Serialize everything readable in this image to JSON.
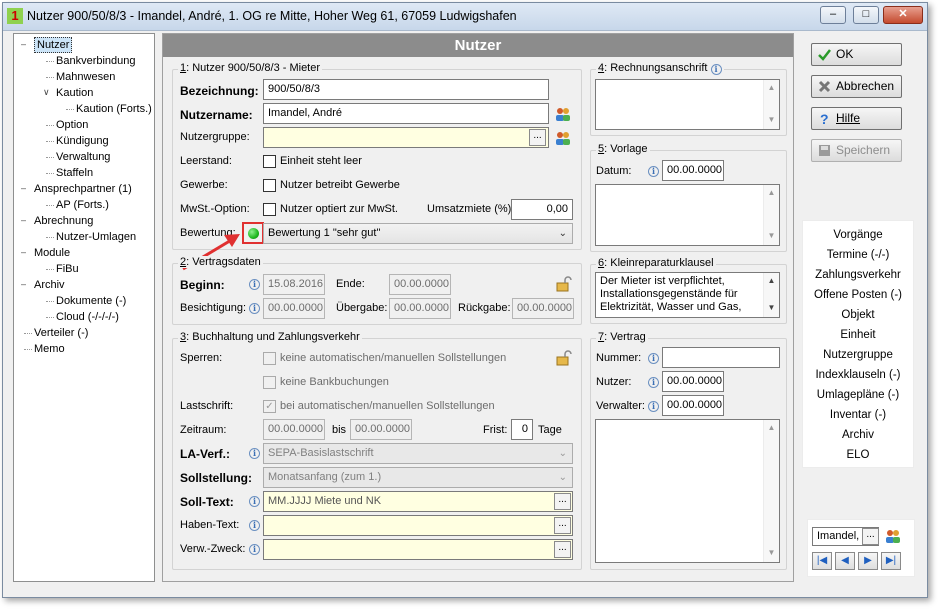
{
  "window": {
    "title": "Nutzer 900/50/8/3 - Imandel, André, 1. OG re Mitte, Hoher Weg 61, 67059 Ludwigshafen"
  },
  "tree": [
    {
      "label": "Nutzer",
      "level": 0,
      "toggle": "-"
    },
    {
      "label": "Bankverbindung",
      "level": 1
    },
    {
      "label": "Mahnwesen",
      "level": 1
    },
    {
      "label": "Kaution",
      "level": 1,
      "toggle": "v"
    },
    {
      "label": "Kaution (Forts.)",
      "level": 2
    },
    {
      "label": "Option",
      "level": 1
    },
    {
      "label": "Kündigung",
      "level": 1
    },
    {
      "label": "Verwaltung",
      "level": 1
    },
    {
      "label": "Staffeln",
      "level": 1
    },
    {
      "label": "Ansprechpartner (1)",
      "level": 0,
      "toggle": "-"
    },
    {
      "label": "AP (Forts.)",
      "level": 1
    },
    {
      "label": "Abrechnung",
      "level": 0,
      "toggle": "-"
    },
    {
      "label": "Nutzer-Umlagen",
      "level": 1
    },
    {
      "label": "Module",
      "level": 0,
      "toggle": "-"
    },
    {
      "label": "FiBu",
      "level": 1
    },
    {
      "label": "Archiv",
      "level": 0,
      "toggle": "-"
    },
    {
      "label": "Dokumente (-)",
      "level": 1
    },
    {
      "label": "Cloud (-/-/-/-)",
      "level": 1
    },
    {
      "label": "Verteiler (-)",
      "level": 0
    },
    {
      "label": "Memo",
      "level": 0
    }
  ],
  "main": {
    "header": "Nutzer"
  },
  "g1": {
    "num": "1",
    "title": ": Nutzer 900/50/8/3 - Mieter",
    "bezeichnung_label": "Bezeichnung:",
    "bezeichnung": "900/50/8/3",
    "nutzername_label": "Nutzername:",
    "nutzername": "Imandel, André",
    "nutzergruppe_label": "Nutzergruppe:",
    "nutzergruppe": "",
    "leerstand_label": "Leerstand:",
    "leerstand_chk": "Einheit steht leer",
    "gewerbe_label": "Gewerbe:",
    "gewerbe_chk": "Nutzer betreibt Gewerbe",
    "mwst_label": "MwSt.-Option:",
    "mwst_chk": "Nutzer optiert zur MwSt.",
    "umsatz_label": "Umsatzmiete (%):",
    "umsatz": "0,00",
    "bewertung_label": "Bewertung:",
    "bewertung": "Bewertung 1 \"sehr gut\"",
    "dots": "...",
    "status_color": "#1fb81f",
    "highlight_color": "#e03030"
  },
  "g2": {
    "num": "2",
    "title": ": Vertragsdaten",
    "beginn_label": "Beginn:",
    "beginn": "15.08.2016",
    "ende_label": "Ende:",
    "ende": "00.00.0000",
    "besichtigung_label": "Besichtigung:",
    "besichtigung": "00.00.0000",
    "uebergabe_label": "Übergabe:",
    "uebergabe": "00.00.0000",
    "rueckgabe_label": "Rückgabe:",
    "rueckgabe": "00.00.0000"
  },
  "g3": {
    "num": "3",
    "title": ": Buchhaltung und Zahlungsverkehr",
    "sperren_label": "Sperren:",
    "sperren_chk1": "keine automatischen/manuellen Sollstellungen",
    "sperren_chk2": "keine Bankbuchungen",
    "lastschrift_label": "Lastschrift:",
    "lastschrift_chk": "bei automatischen/manuellen Sollstellungen",
    "zeitraum_label": "Zeitraum:",
    "zeitraum_von": "00.00.0000",
    "bis_label": "bis",
    "zeitraum_bis": "00.00.0000",
    "frist_label": "Frist:",
    "frist": "0",
    "tage_label": "Tage",
    "laverf_label": "LA-Verf.:",
    "laverf": "SEPA-Basislastschrift",
    "sollstellung_label": "Sollstellung:",
    "sollstellung": "Monatsanfang (zum 1.)",
    "solltext_label": "Soll-Text:",
    "solltext": "MM.JJJJ Miete und NK",
    "habentext_label": "Haben-Text:",
    "habentext": "",
    "verwzweck_label": "Verw.-Zweck:",
    "verwzweck": ""
  },
  "g4": {
    "num": "4",
    "title": ": Rechnungsanschrift"
  },
  "g5": {
    "num": "5",
    "title": ": Vorlage",
    "datum_label": "Datum:",
    "datum": "00.00.0000"
  },
  "g6": {
    "num": "6",
    "title": ": Kleinreparaturklausel",
    "text": "Der Mieter ist verpflichtet, Installationsgegenstände für Elektrizität, Wasser und Gas,"
  },
  "g7": {
    "num": "7",
    "title": ": Vertrag",
    "nummer_label": "Nummer:",
    "nummer": "",
    "nutzer_label": "Nutzer:",
    "nutzer": "00.00.0000",
    "verwalter_label": "Verwalter:",
    "verwalter": "00.00.0000"
  },
  "buttons": {
    "ok": "OK",
    "abbrechen": "Abbrechen",
    "hilfe": "Hilfe",
    "speichern": "Speichern"
  },
  "links": [
    "Vorgänge",
    "Termine (-/-)",
    "Zahlungsverkehr",
    "Offene Posten (-)",
    "Objekt",
    "Einheit",
    "Nutzergruppe",
    "Indexklauseln (-)",
    "Umlagepläne (-)",
    "Inventar (-)",
    "Archiv",
    "ELO"
  ],
  "nav": {
    "name": "Imandel,",
    "dots": "..."
  }
}
